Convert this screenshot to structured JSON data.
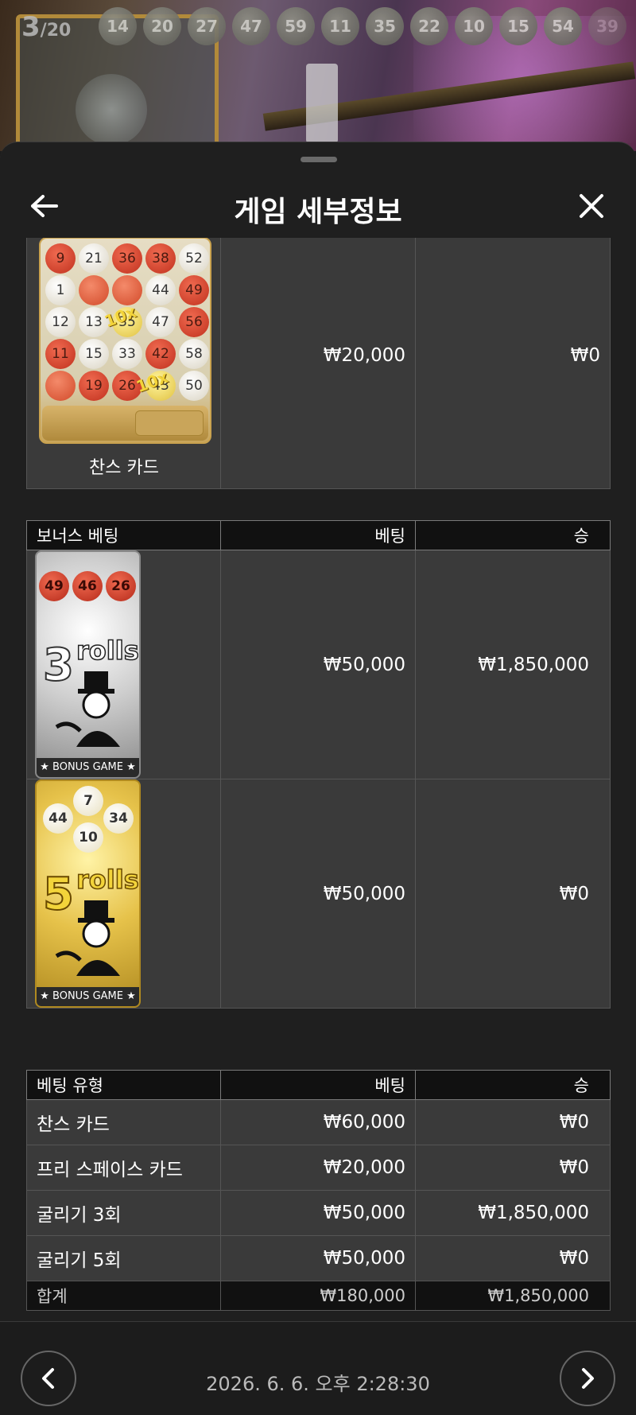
{
  "top_strip": {
    "round_current": "3",
    "round_total": "/20",
    "drawn_balls": [
      "14",
      "20",
      "27",
      "47",
      "59",
      "11",
      "35",
      "22",
      "10",
      "15",
      "54",
      "39"
    ]
  },
  "header": {
    "title": "게임 세부정보"
  },
  "chance_card": {
    "caption": "찬스 카드",
    "bet": "₩20,000",
    "win": "₩0",
    "card_numbers": [
      [
        "9",
        "21",
        "36",
        "38",
        "52"
      ],
      [
        "1",
        "",
        "",
        "44",
        "49"
      ],
      [
        "12",
        "13",
        "35",
        "47",
        "56"
      ],
      [
        "11",
        "15",
        "33",
        "42",
        "58"
      ],
      [
        "",
        "19",
        "26",
        "43",
        "50"
      ]
    ],
    "multiplier_label": "10x"
  },
  "bonus_table": {
    "headers": [
      "보너스 베팅",
      "베팅",
      "승"
    ],
    "rows": [
      {
        "card": {
          "balls": [
            "49",
            "46",
            "26"
          ],
          "number": "3",
          "rolls_word": "rolls",
          "label": "★ BONUS GAME ★"
        },
        "bet": "₩50,000",
        "win": "₩1,850,000"
      },
      {
        "card": {
          "balls": [
            "7",
            "44",
            "34",
            "10"
          ],
          "number": "5",
          "rolls_word": "rolls",
          "label": "★ BONUS GAME ★"
        },
        "bet": "₩50,000",
        "win": "₩0"
      }
    ]
  },
  "summary_table": {
    "headers": [
      "베팅 유형",
      "베팅",
      "승"
    ],
    "rows": [
      {
        "type": "찬스 카드",
        "bet": "₩60,000",
        "win": "₩0"
      },
      {
        "type": "프리 스페이스 카드",
        "bet": "₩20,000",
        "win": "₩0"
      },
      {
        "type": "굴리기 3회",
        "bet": "₩50,000",
        "win": "₩1,850,000"
      },
      {
        "type": "굴리기 5회",
        "bet": "₩50,000",
        "win": "₩0"
      }
    ],
    "total": {
      "label": "합계",
      "bet": "₩180,000",
      "win": "₩1,850,000"
    }
  },
  "footer": {
    "timestamp": "2026. 6. 6. 오후 2:28:30"
  },
  "colors": {
    "panel_bg": "#1f1f1f",
    "row_bg": "#3a3a3a",
    "header_bg": "#111111",
    "red_ball": "#d8432a",
    "gold": "#f3d43a"
  }
}
